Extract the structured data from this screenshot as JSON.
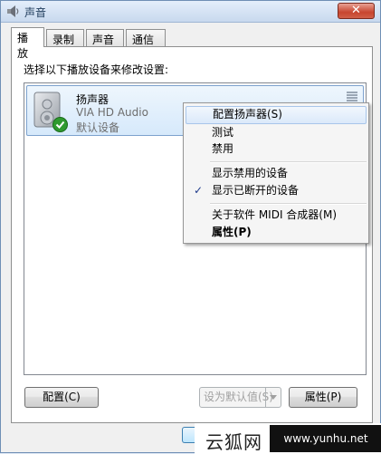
{
  "window": {
    "title": "声音",
    "close_glyph": "✕"
  },
  "tabs": [
    {
      "label": "播放"
    },
    {
      "label": "录制"
    },
    {
      "label": "声音"
    },
    {
      "label": "通信"
    }
  ],
  "panel": {
    "instruction": "选择以下播放设备来修改设置:"
  },
  "device": {
    "name": "扬声器",
    "driver": "VIA HD Audio",
    "status": "默认设备",
    "icon": "speaker-icon",
    "badge_icon": "green-check-icon"
  },
  "context_menu": {
    "items": [
      {
        "label": "配置扬声器(S)"
      },
      {
        "label": "测试"
      },
      {
        "label": "禁用"
      },
      {
        "label": "显示禁用的设备"
      },
      {
        "label": "显示已断开的设备"
      },
      {
        "label": "关于软件 MIDI 合成器(M)"
      },
      {
        "label": "属性(P)"
      }
    ],
    "check_glyph": "✓"
  },
  "buttons": {
    "configure": "配置(C)",
    "set_default": "设为默认值(S)",
    "properties": "属性(P)"
  },
  "watermark": {
    "cn": "云狐网",
    "url": "www.yunhu.net"
  },
  "colors": {
    "selection": "#d6e9fb",
    "menu_highlight": "#dbe9fa",
    "close": "#c7452f"
  }
}
